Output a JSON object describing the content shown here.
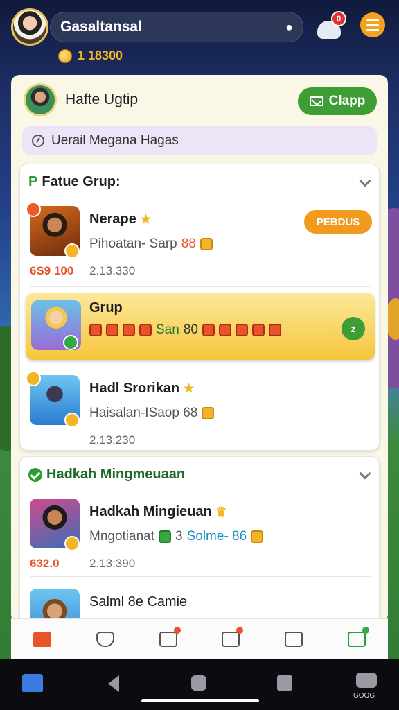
{
  "header": {
    "search_text": "Gasaltansal",
    "coins": "1 18300",
    "notification_count": "0"
  },
  "group": {
    "title": "Hafte Ugtip",
    "clapp_label": "Clapp",
    "info_text": "Uerail Megana Hagas"
  },
  "section1": {
    "prefix": "P",
    "title": "Fatue Grup:",
    "items": [
      {
        "name": "Nerape",
        "subtitle": "Pihoatan- Sarp",
        "sub_num": "88",
        "time": "2.13.330",
        "score": "6S9 100",
        "action_label": "PEBDUS"
      },
      {
        "name": "Grup",
        "gift_text": "San",
        "gift_num": "80",
        "action_label": "z"
      },
      {
        "name": "Hadl Srorikan",
        "subtitle": "Haisalan-ISaop 68",
        "time": "2.13:230"
      }
    ]
  },
  "section2": {
    "title": "Hadkah Mingmeuaan",
    "items": [
      {
        "name": "Hadkah Mingieuan",
        "subtitle": "Mngotianat",
        "sub_num": "3",
        "sub_blue": "Solme- 86",
        "time": "2.13:390",
        "score": "632.0"
      },
      {
        "name": "Salml 8e Camie"
      }
    ]
  },
  "system_nav": {
    "label": "GOOG"
  },
  "colors": {
    "accent_green": "#3e9d35",
    "accent_orange": "#f29a1e",
    "highlight_yellow": "#f6c63c"
  }
}
